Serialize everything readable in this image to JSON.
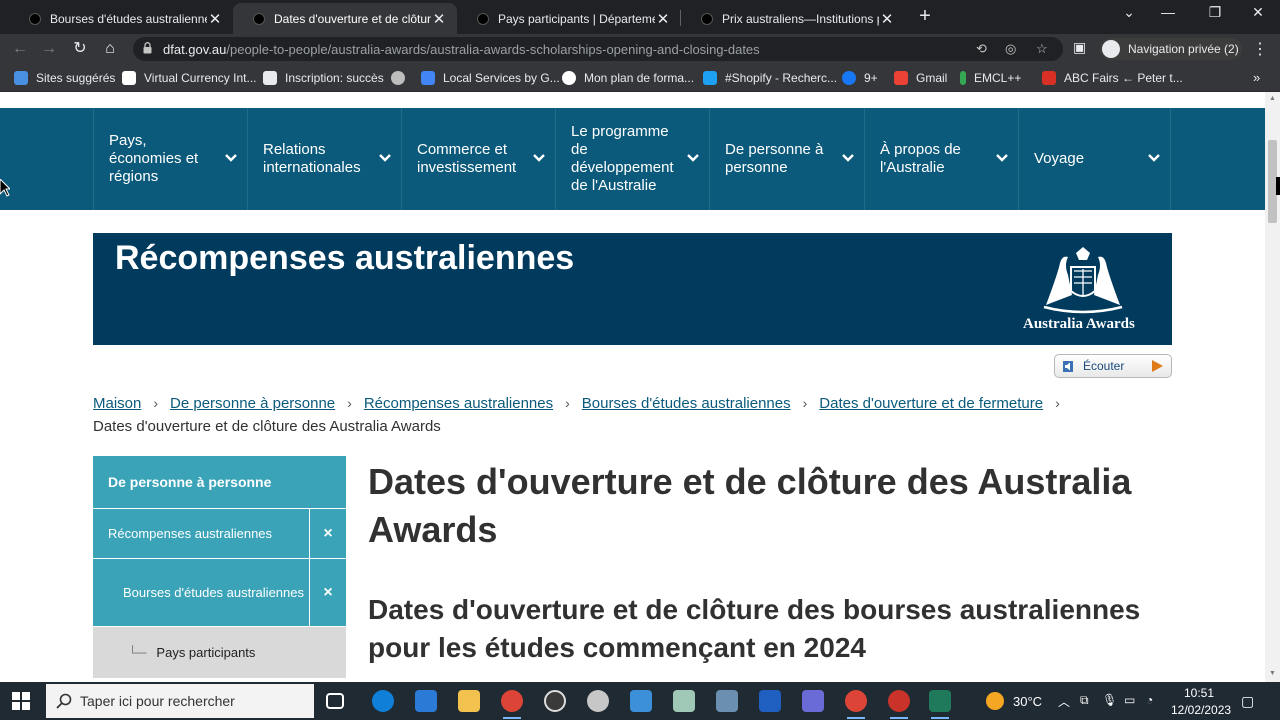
{
  "browser": {
    "tabs": [
      {
        "label": "Bourses d'études australiennes | D",
        "active": false
      },
      {
        "label": "Dates d'ouverture et de clôture d",
        "active": true
      },
      {
        "label": "Pays participants | Département d",
        "active": false
      },
      {
        "label": "Prix australiens—Institutions part",
        "active": false
      }
    ],
    "url_host": "dfat.gov.au",
    "url_path": "/people-to-people/australia-awards/australia-awards-scholarships-opening-and-closing-dates",
    "profile_label": "Navigation privée (2)",
    "bookmarks": [
      {
        "label": "Sites suggérés",
        "color": "#4a90e2"
      },
      {
        "label": "Virtual Currency Int...",
        "color": "#ffffff"
      },
      {
        "label": "Inscription: succès",
        "color": "#e8eaed"
      },
      {
        "label": "",
        "color": "#bdbdbd"
      },
      {
        "label": "Local Services by G...",
        "color": "#4285f4"
      },
      {
        "label": "Mon plan de forma...",
        "color": "#ffffff"
      },
      {
        "label": "#Shopify - Recherc...",
        "color": "#1da1f2"
      },
      {
        "label": "9+",
        "color": "#1877f2"
      },
      {
        "label": "Gmail",
        "color": "#ea4335"
      },
      {
        "label": "EMCL++",
        "color": "#34a853"
      },
      {
        "label": "ABC Fairs ← Peter t...",
        "color": "#d93025"
      }
    ]
  },
  "site": {
    "nav": [
      {
        "label": "Pays, économies et régions"
      },
      {
        "label": "Relations internationales"
      },
      {
        "label": "Commerce et investissement"
      },
      {
        "label": "Le programme de développement de l'Australie"
      },
      {
        "label": "De personne à personne"
      },
      {
        "label": "À propos de l'Australie"
      },
      {
        "label": "Voyage"
      }
    ],
    "banner_title": "Récompenses australiennes",
    "banner_logo_text": "Australia Awards",
    "listen_label": "Écouter",
    "breadcrumbs": [
      "Maison",
      "De personne à personne",
      "Récompenses australiennes",
      "Bourses d'études australiennes",
      "Dates d'ouverture et de fermeture"
    ],
    "breadcrumb_current": "Dates d'ouverture et de clôture des Australia Awards",
    "sidebar": {
      "heading": "De personne à personne",
      "items": [
        {
          "label": "Récompenses australiennes",
          "close": "×"
        },
        {
          "label": "Bourses d'études australiennes",
          "close": "×"
        }
      ],
      "sub_item": "Pays participants",
      "tree_glyph": "└─"
    },
    "page_title": "Dates d'ouverture et de clôture des Australia Awards",
    "section_title": "Dates d'ouverture et de clôture des bourses australiennes pour les études commençant en 2024"
  },
  "taskbar": {
    "search_placeholder": "Taper ici pour rechercher",
    "temperature": "30°C",
    "time": "10:51",
    "date": "12/02/2023"
  },
  "colors": {
    "nav_bg": "#0b5a7b",
    "banner_bg": "#003a5d",
    "sidebar_bg": "#3aa3b8",
    "link": "#0b5a7b"
  }
}
